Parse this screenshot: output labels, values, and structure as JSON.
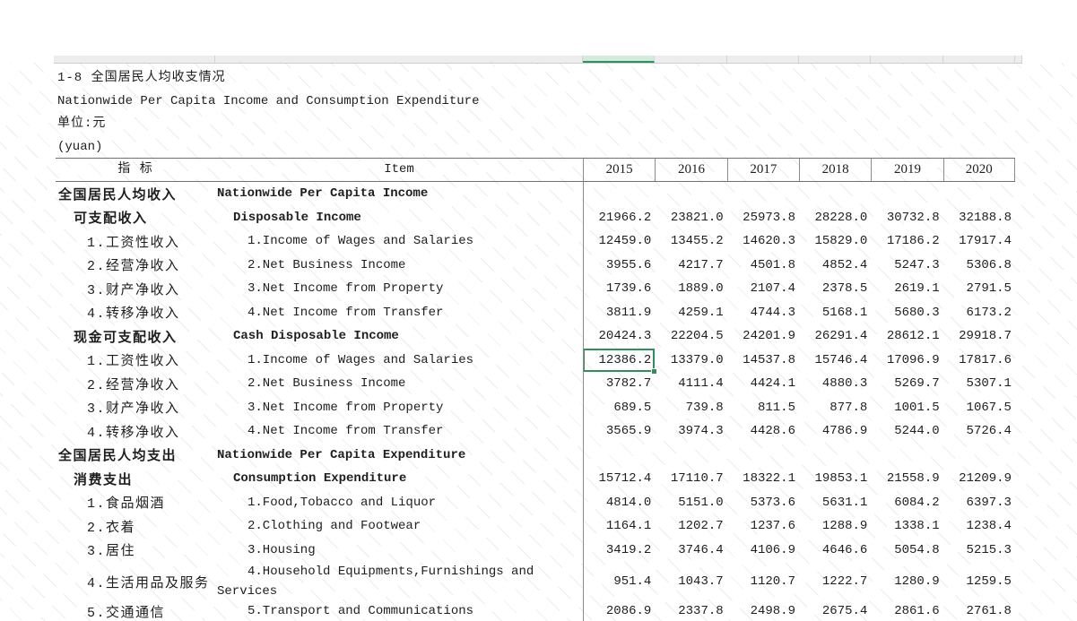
{
  "title_cn": "1-8 全国居民人均收支情况",
  "title_en": "Nationwide Per Capita Income and Consumption Expenditure",
  "unit_cn": "单位:元",
  "unit_en": "(yuan)",
  "header": {
    "indicator": "指 标",
    "item": "Item",
    "years": [
      "2015",
      "2016",
      "2017",
      "2018",
      "2019",
      "2020"
    ]
  },
  "selected_cell": {
    "row": 7,
    "column": 0
  },
  "colors": {
    "selection": "#2f8f5e",
    "selected_column_header": "#d2ebdc",
    "text": "#1e1e1e"
  },
  "rows": [
    {
      "cn": "全国居民人均收入",
      "en": "Nationwide Per Capita Income",
      "level": 0,
      "values": []
    },
    {
      "cn": "可支配收入",
      "en": "Disposable Income",
      "level": 1,
      "values": [
        "21966.2",
        "23821.0",
        "25973.8",
        "28228.0",
        "30732.8",
        "32188.8"
      ]
    },
    {
      "cn": "1.工资性收入",
      "en": "1.Income of Wages and Salaries",
      "level": 2,
      "values": [
        "12459.0",
        "13455.2",
        "14620.3",
        "15829.0",
        "17186.2",
        "17917.4"
      ]
    },
    {
      "cn": "2.经营净收入",
      "en": "2.Net Business Income",
      "level": 2,
      "values": [
        "3955.6",
        "4217.7",
        "4501.8",
        "4852.4",
        "5247.3",
        "5306.8"
      ]
    },
    {
      "cn": "3.财产净收入",
      "en": "3.Net Income from Property",
      "level": 2,
      "values": [
        "1739.6",
        "1889.0",
        "2107.4",
        "2378.5",
        "2619.1",
        "2791.5"
      ]
    },
    {
      "cn": "4.转移净收入",
      "en": "4.Net Income from Transfer",
      "level": 2,
      "values": [
        "3811.9",
        "4259.1",
        "4744.3",
        "5168.1",
        "5680.3",
        "6173.2"
      ]
    },
    {
      "cn": "现金可支配收入",
      "en": "Cash Disposable Income",
      "level": 1,
      "values": [
        "20424.3",
        "22204.5",
        "24201.9",
        "26291.4",
        "28612.1",
        "29918.7"
      ]
    },
    {
      "cn": "1.工资性收入",
      "en": "1.Income of Wages and Salaries",
      "level": 2,
      "values": [
        "12386.2",
        "13379.0",
        "14537.8",
        "15746.4",
        "17096.9",
        "17817.6"
      ]
    },
    {
      "cn": "2.经营净收入",
      "en": "2.Net Business Income",
      "level": 2,
      "values": [
        "3782.7",
        "4111.4",
        "4424.1",
        "4880.3",
        "5269.7",
        "5307.1"
      ]
    },
    {
      "cn": "3.财产净收入",
      "en": "3.Net Income from Property",
      "level": 2,
      "values": [
        "689.5",
        "739.8",
        "811.5",
        "877.8",
        "1001.5",
        "1067.5"
      ]
    },
    {
      "cn": "4.转移净收入",
      "en": "4.Net Income from Transfer",
      "level": 2,
      "values": [
        "3565.9",
        "3974.3",
        "4428.6",
        "4786.9",
        "5244.0",
        "5726.4"
      ]
    },
    {
      "cn": "全国居民人均支出",
      "en": "Nationwide Per Capita Expenditure",
      "level": 0,
      "values": []
    },
    {
      "cn": "消费支出",
      "en": "Consumption Expenditure",
      "level": 1,
      "values": [
        "15712.4",
        "17110.7",
        "18322.1",
        "19853.1",
        "21558.9",
        "21209.9"
      ]
    },
    {
      "cn": "1.食品烟酒",
      "en": "1.Food,Tobacco and Liquor",
      "level": 2,
      "values": [
        "4814.0",
        "5151.0",
        "5373.6",
        "5631.1",
        "6084.2",
        "6397.3"
      ]
    },
    {
      "cn": "2.衣着",
      "en": "2.Clothing and Footwear",
      "level": 2,
      "values": [
        "1164.1",
        "1202.7",
        "1237.6",
        "1288.9",
        "1338.1",
        "1238.4"
      ]
    },
    {
      "cn": "3.居住",
      "en": "3.Housing",
      "level": 2,
      "values": [
        "3419.2",
        "3746.4",
        "4106.9",
        "4646.6",
        "5054.8",
        "5215.3"
      ]
    },
    {
      "cn": "4.生活用品及服务",
      "en": "4.Household Equipments,Furnishings and Services",
      "level": 2,
      "values": [
        "951.4",
        "1043.7",
        "1120.7",
        "1222.7",
        "1280.9",
        "1259.5"
      ]
    },
    {
      "cn": "5.交通通信",
      "en": "5.Transport and Communications",
      "level": 2,
      "values": [
        "2086.9",
        "2337.8",
        "2498.9",
        "2675.4",
        "2861.6",
        "2761.8"
      ]
    }
  ]
}
